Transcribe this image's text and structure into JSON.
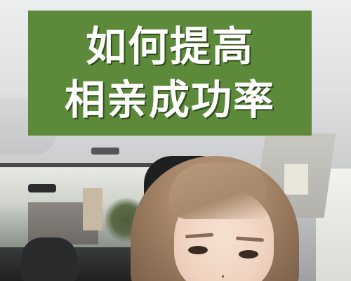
{
  "title": {
    "line1": "如何提高",
    "line2": "相亲成功率",
    "background_color": "#5d8a3a",
    "text_color": "#ffffff"
  }
}
